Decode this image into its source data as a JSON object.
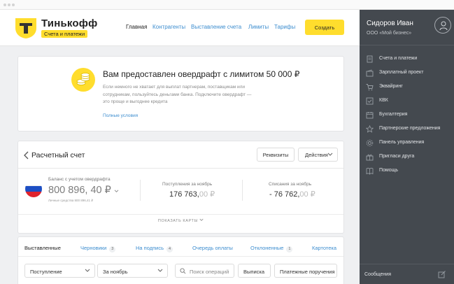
{
  "header": {
    "brand": "Тинькофф",
    "brand_tag": "Счета и платежи",
    "nav": [
      {
        "label": "Главная",
        "active": true
      },
      {
        "label": "Контрагенты"
      },
      {
        "label": "Выставление счета"
      },
      {
        "label": "Лимиты"
      },
      {
        "label": "Тарифы"
      }
    ],
    "create_label": "Создать"
  },
  "promo": {
    "title": "Вам предоставлен овердрафт с лимитом 50 000 ₽",
    "text": "Если немного не хватает для выплат партнерам, поставщикам или сотрудникам, пользуйтесь деньгами банка. Подключите овердрафт — это проще и выгоднее кредита",
    "link": "Полные условия"
  },
  "account": {
    "title": "Расчетный счет",
    "requisites_label": "Реквизиты",
    "actions_label": "Действия",
    "balance_label": "Баланс с учетом овердрафта",
    "balance_value": "800 896, 40 ₽",
    "own_funds": "Личные средства 800 896,41 ₽",
    "income_label": "Поступления за ноябрь",
    "income_value": "176 763,",
    "income_cents": "00 ₽",
    "expense_label": "Списания за ноябрь",
    "expense_value": "- 76 762,",
    "expense_cents": "00 ₽",
    "show_cards": "ПОКАЗАТЬ КАРТЫ"
  },
  "documents": {
    "tabs": [
      {
        "label": "Выставленные",
        "active": true
      },
      {
        "label": "Черновики",
        "badge": "3"
      },
      {
        "label": "На подпись",
        "badge": "4"
      },
      {
        "label": "Очередь оплаты"
      },
      {
        "label": "Отклоненные",
        "badge": "1"
      },
      {
        "label": "Картотека"
      }
    ],
    "filter_type": "Поступление",
    "filter_period": "За ноябрь",
    "search_placeholder": "Поиск операций",
    "statement_label": "Выписка",
    "orders_label": "Платежные поручения"
  },
  "sidebar": {
    "user_name": "Сидоров Иван",
    "org": "ООО «Мой бизнес»",
    "items": [
      {
        "label": "Счета и платежи",
        "icon": "document-icon"
      },
      {
        "label": "Зарплатный проект",
        "icon": "wallet-icon"
      },
      {
        "label": "Эквайринг",
        "icon": "cart-icon"
      },
      {
        "label": "КВК",
        "icon": "check-icon"
      },
      {
        "label": "Бухгалтерия",
        "icon": "calendar-icon"
      },
      {
        "label": "Партнерские предложения",
        "icon": "star-icon"
      },
      {
        "label": "Панель управления",
        "icon": "gear-icon"
      },
      {
        "label": "Пригласи друга",
        "icon": "gift-icon"
      },
      {
        "label": "Помощь",
        "icon": "book-icon"
      }
    ],
    "messages_label": "Сообщения"
  },
  "colors": {
    "accent": "#ffdd2d",
    "link": "#3c8dcf",
    "sidebar": "#44494f"
  }
}
